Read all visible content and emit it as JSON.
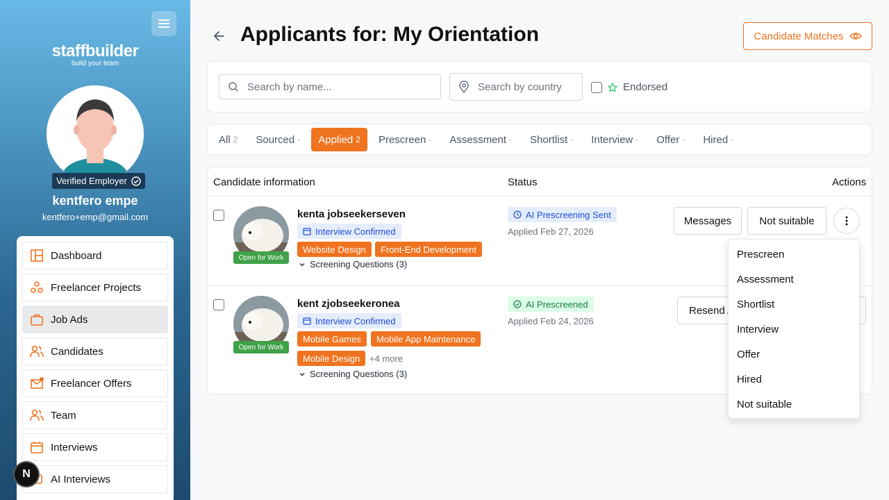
{
  "sidebar": {
    "logo_name": "staffbuilder",
    "logo_tagline": "build your team",
    "verified_label": "Verified Employer",
    "user_name": "kentfero empe",
    "user_email": "kentfero+emp@gmail.com",
    "items": [
      {
        "label": "Dashboard"
      },
      {
        "label": "Freelancer Projects"
      },
      {
        "label": "Job Ads"
      },
      {
        "label": "Candidates"
      },
      {
        "label": "Freelancer Offers"
      },
      {
        "label": "Team"
      },
      {
        "label": "Interviews"
      },
      {
        "label": "AI Interviews"
      }
    ],
    "active_item": "Job Ads",
    "badge_letter": "N"
  },
  "header": {
    "title": "Applicants for: My Orientation",
    "matches_button": "Candidate Matches"
  },
  "filters": {
    "name_placeholder": "Search by name...",
    "country_placeholder": "Search by country",
    "endorsed_label": "Endorsed"
  },
  "tabs": [
    {
      "label": "All",
      "count": "2"
    },
    {
      "label": "Sourced",
      "count": "-"
    },
    {
      "label": "Applied",
      "count": "2"
    },
    {
      "label": "Prescreen",
      "count": "-"
    },
    {
      "label": "Assessment",
      "count": "-"
    },
    {
      "label": "Shortlist",
      "count": "-"
    },
    {
      "label": "Interview",
      "count": "-"
    },
    {
      "label": "Offer",
      "count": "-"
    },
    {
      "label": "Hired",
      "count": "-"
    }
  ],
  "active_tab": "Applied",
  "table": {
    "headers": {
      "candidate": "Candidate information",
      "status": "Status",
      "actions": "Actions"
    },
    "rows": [
      {
        "name": "kenta jobseekerseven",
        "open_label": "Open for Work",
        "interview_badge": "Interview Confirmed",
        "skills": [
          "Website Design",
          "Front-End Development"
        ],
        "more": "",
        "screening": "Screening Questions (3)",
        "status": "AI Prescreening Sent",
        "applied": "Applied Feb 27, 2026",
        "action_primary": "Messages",
        "action_secondary": "Not suitable"
      },
      {
        "name": "kent zjobseekeronea",
        "open_label": "Open for Work",
        "interview_badge": "Interview Confirmed",
        "skills": [
          "Mobile Games",
          "Mobile App Maintenance",
          "Mobile Design"
        ],
        "more": "+4 more",
        "screening": "Screening Questions (3)",
        "status": "AI Prescreened",
        "applied": "Applied Feb 24, 2026",
        "action_primary": "Resend A"
      }
    ]
  },
  "dropdown": {
    "items": [
      "Prescreen",
      "Assessment",
      "Shortlist",
      "Interview",
      "Offer",
      "Hired",
      "Not suitable"
    ]
  },
  "colors": {
    "accent": "#f0731f",
    "sidebar_top": "#69b9e6",
    "sidebar_bottom": "#1d4a6e",
    "open_for_work": "#3fa148"
  }
}
